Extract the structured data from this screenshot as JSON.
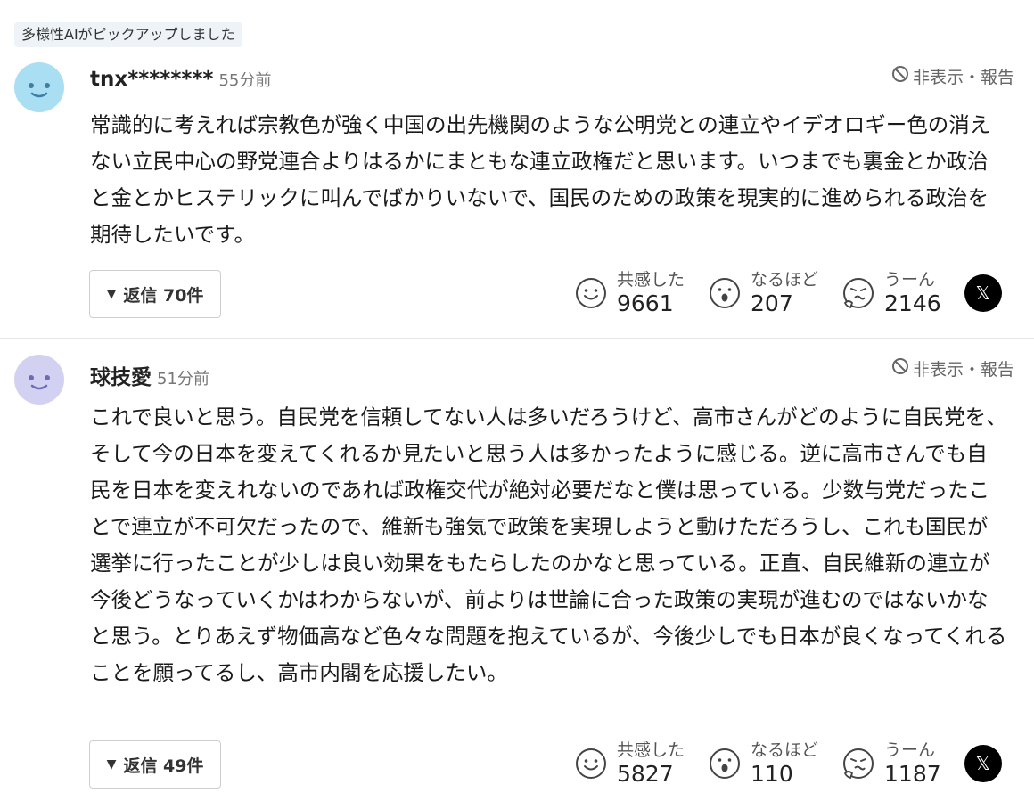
{
  "pick_badge": "多様性AIがピックアップしました",
  "comments": [
    {
      "avatar_color": "#a9def3",
      "username": "tnx********",
      "time": "55分前",
      "hide_report": "非表示・報告",
      "body": "常識的に考えれば宗教色が強く中国の出先機関のような公明党との連立やイデオロギー色の消えない立民中心の野党連合よりはるかにまともな連立政権だと思います。いつまでも裏金とか政治と金とかヒステリックに叫んでばかりいないで、国民のための政策を現実的に進められる政治を期待したいです。",
      "reply_label": "返信 70件",
      "reactions": [
        {
          "icon": "smile-face-icon",
          "label": "共感した",
          "count": "9661"
        },
        {
          "icon": "surprised-face-icon",
          "label": "なるほど",
          "count": "207"
        },
        {
          "icon": "thinking-face-icon",
          "label": "うーん",
          "count": "2146"
        }
      ],
      "share_icon": "x-logo-icon"
    },
    {
      "avatar_color": "#d2d1f2",
      "username": "球技愛",
      "time": "51分前",
      "hide_report": "非表示・報告",
      "body": "これで良いと思う。自民党を信頼してない人は多いだろうけど、高市さんがどのように自民党を、そして今の日本を変えてくれるか見たいと思う人は多かったように感じる。逆に高市さんでも自民を日本を変えれないのであれば政権交代が絶対必要だなと僕は思っている。少数与党だったことで連立が不可欠だったので、維新も強気で政策を実現しようと動けただろうし、これも国民が選挙に行ったことが少しは良い効果をもたらしたのかなと思っている。正直、自民維新の連立が今後どうなっていくかはわからないが、前よりは世論に合った政策の実現が進むのではないかなと思う。とりあえず物価高など色々な問題を抱えているが、今後少しでも日本が良くなってくれることを願ってるし、高市内閣を応援したい。",
      "reply_label": "返信 49件",
      "reactions": [
        {
          "icon": "smile-face-icon",
          "label": "共感した",
          "count": "5827"
        },
        {
          "icon": "surprised-face-icon",
          "label": "なるほど",
          "count": "110"
        },
        {
          "icon": "thinking-face-icon",
          "label": "うーん",
          "count": "1187"
        }
      ],
      "share_icon": "x-logo-icon"
    }
  ]
}
